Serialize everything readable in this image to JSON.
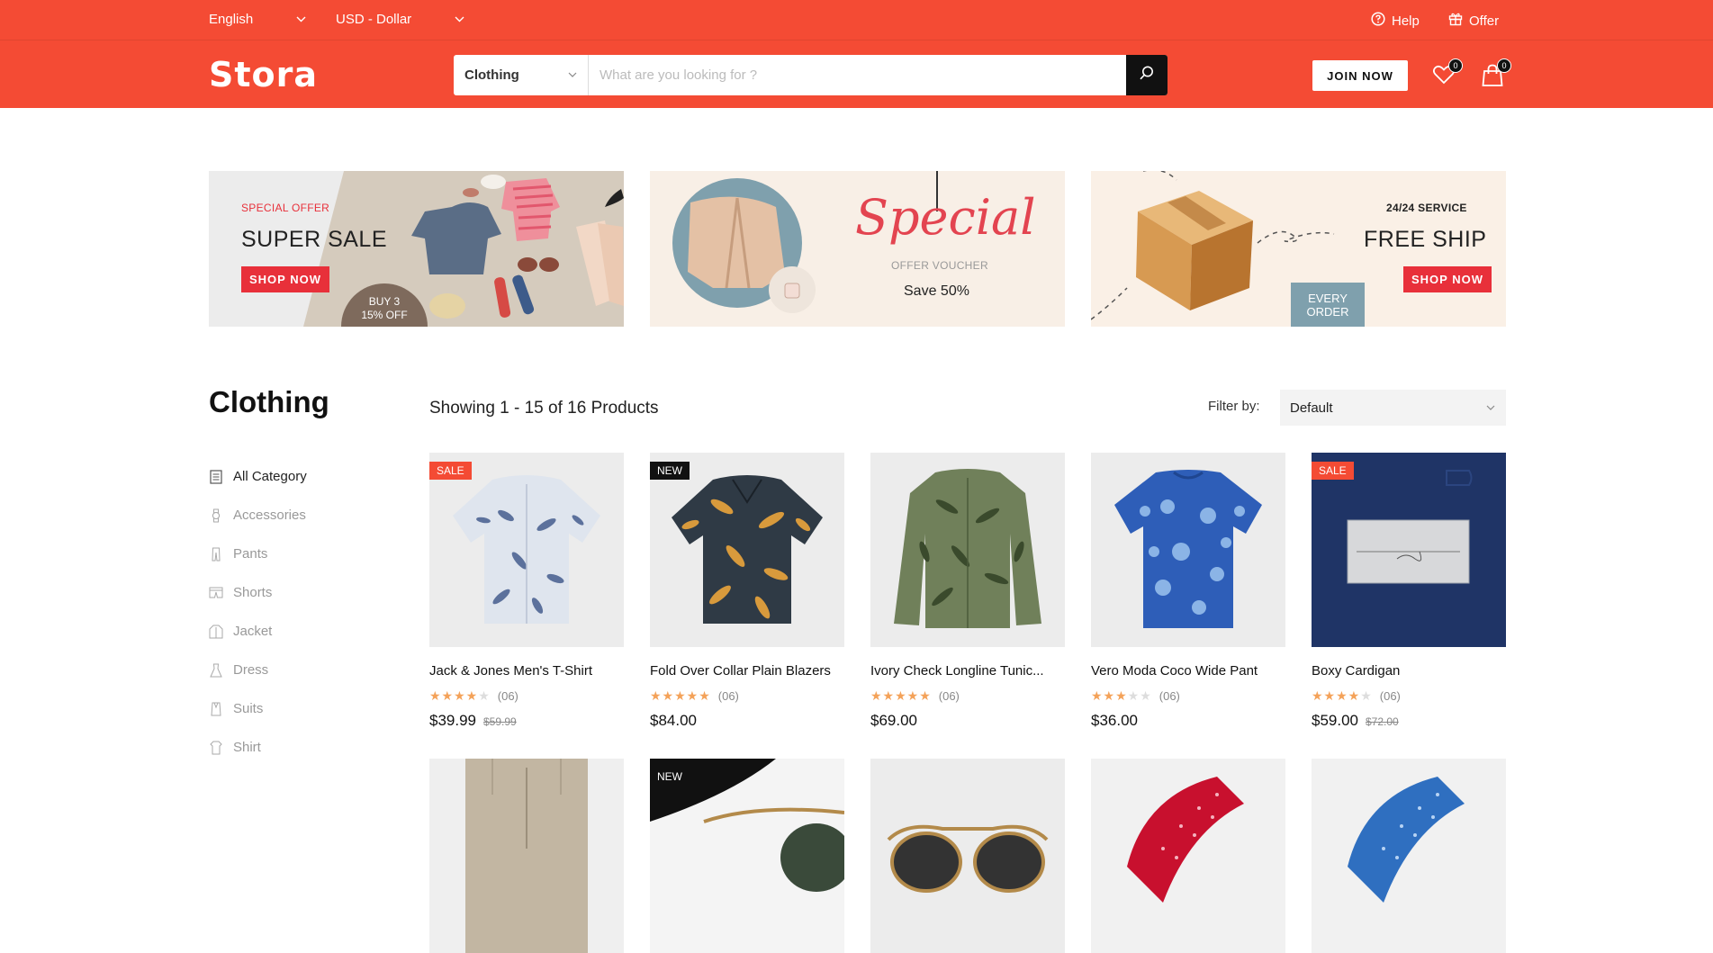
{
  "topbar": {
    "language": "English",
    "currency": "USD - Dollar",
    "help": "Help",
    "offer": "Offer"
  },
  "header": {
    "logo": "Stora",
    "search_category": "Clothing",
    "search_placeholder": "What are you looking for ?",
    "join": "JOIN NOW",
    "wishlist_count": "0",
    "cart_count": "0"
  },
  "banners": [
    {
      "small": "SPECIAL OFFER",
      "big": "SUPER SALE",
      "button": "SHOP NOW",
      "badge_line1": "BUY 3",
      "badge_line2": "15% OFF"
    },
    {
      "script": "Special",
      "small": "OFFER VOUCHER",
      "big": "Save 50%"
    },
    {
      "small": "24/24 SERVICE",
      "big": "FREE SHIP",
      "button": "SHOP NOW",
      "badge_line1": "EVERY",
      "badge_line2": "ORDER"
    }
  ],
  "sidebar": {
    "title": "Clothing",
    "items": [
      {
        "label": "All Category",
        "icon": "list-icon"
      },
      {
        "label": "Accessories",
        "icon": "watch-icon"
      },
      {
        "label": "Pants",
        "icon": "pants-icon"
      },
      {
        "label": "Shorts",
        "icon": "shorts-icon"
      },
      {
        "label": "Jacket",
        "icon": "jacket-icon"
      },
      {
        "label": "Dress",
        "icon": "dress-icon"
      },
      {
        "label": "Suits",
        "icon": "suit-icon"
      },
      {
        "label": "Shirt",
        "icon": "shirt-icon"
      }
    ]
  },
  "listing": {
    "showing": "Showing 1 - 15 of 16 Products",
    "filter_label": "Filter by:",
    "filter_value": "Default"
  },
  "products": [
    {
      "tag": "SALE",
      "name": "Jack & Jones Men's T-Shirt",
      "rating": 4,
      "reviews": "(06)",
      "price": "$39.99",
      "old_price": "$59.99"
    },
    {
      "tag": "NEW",
      "name": "Fold Over Collar Plain Blazers",
      "rating": 5,
      "reviews": "(06)",
      "price": "$84.00",
      "old_price": ""
    },
    {
      "tag": "",
      "name": "Ivory Check Longline Tunic...",
      "rating": 5,
      "reviews": "(06)",
      "price": "$69.00",
      "old_price": ""
    },
    {
      "tag": "",
      "name": "Vero Moda Coco Wide Pant",
      "rating": 3,
      "reviews": "(06)",
      "price": "$36.00",
      "old_price": ""
    },
    {
      "tag": "SALE",
      "name": "Boxy Cardigan",
      "rating": 4,
      "reviews": "(06)",
      "price": "$59.00",
      "old_price": "$72.00"
    },
    {
      "tag": ""
    },
    {
      "tag": "NEW"
    },
    {
      "tag": ""
    },
    {
      "tag": ""
    },
    {
      "tag": ""
    }
  ],
  "colors": {
    "brand": "#f44b34",
    "sale_tag": "#f44b34",
    "new_tag": "#111111",
    "star": "#f4a259"
  }
}
